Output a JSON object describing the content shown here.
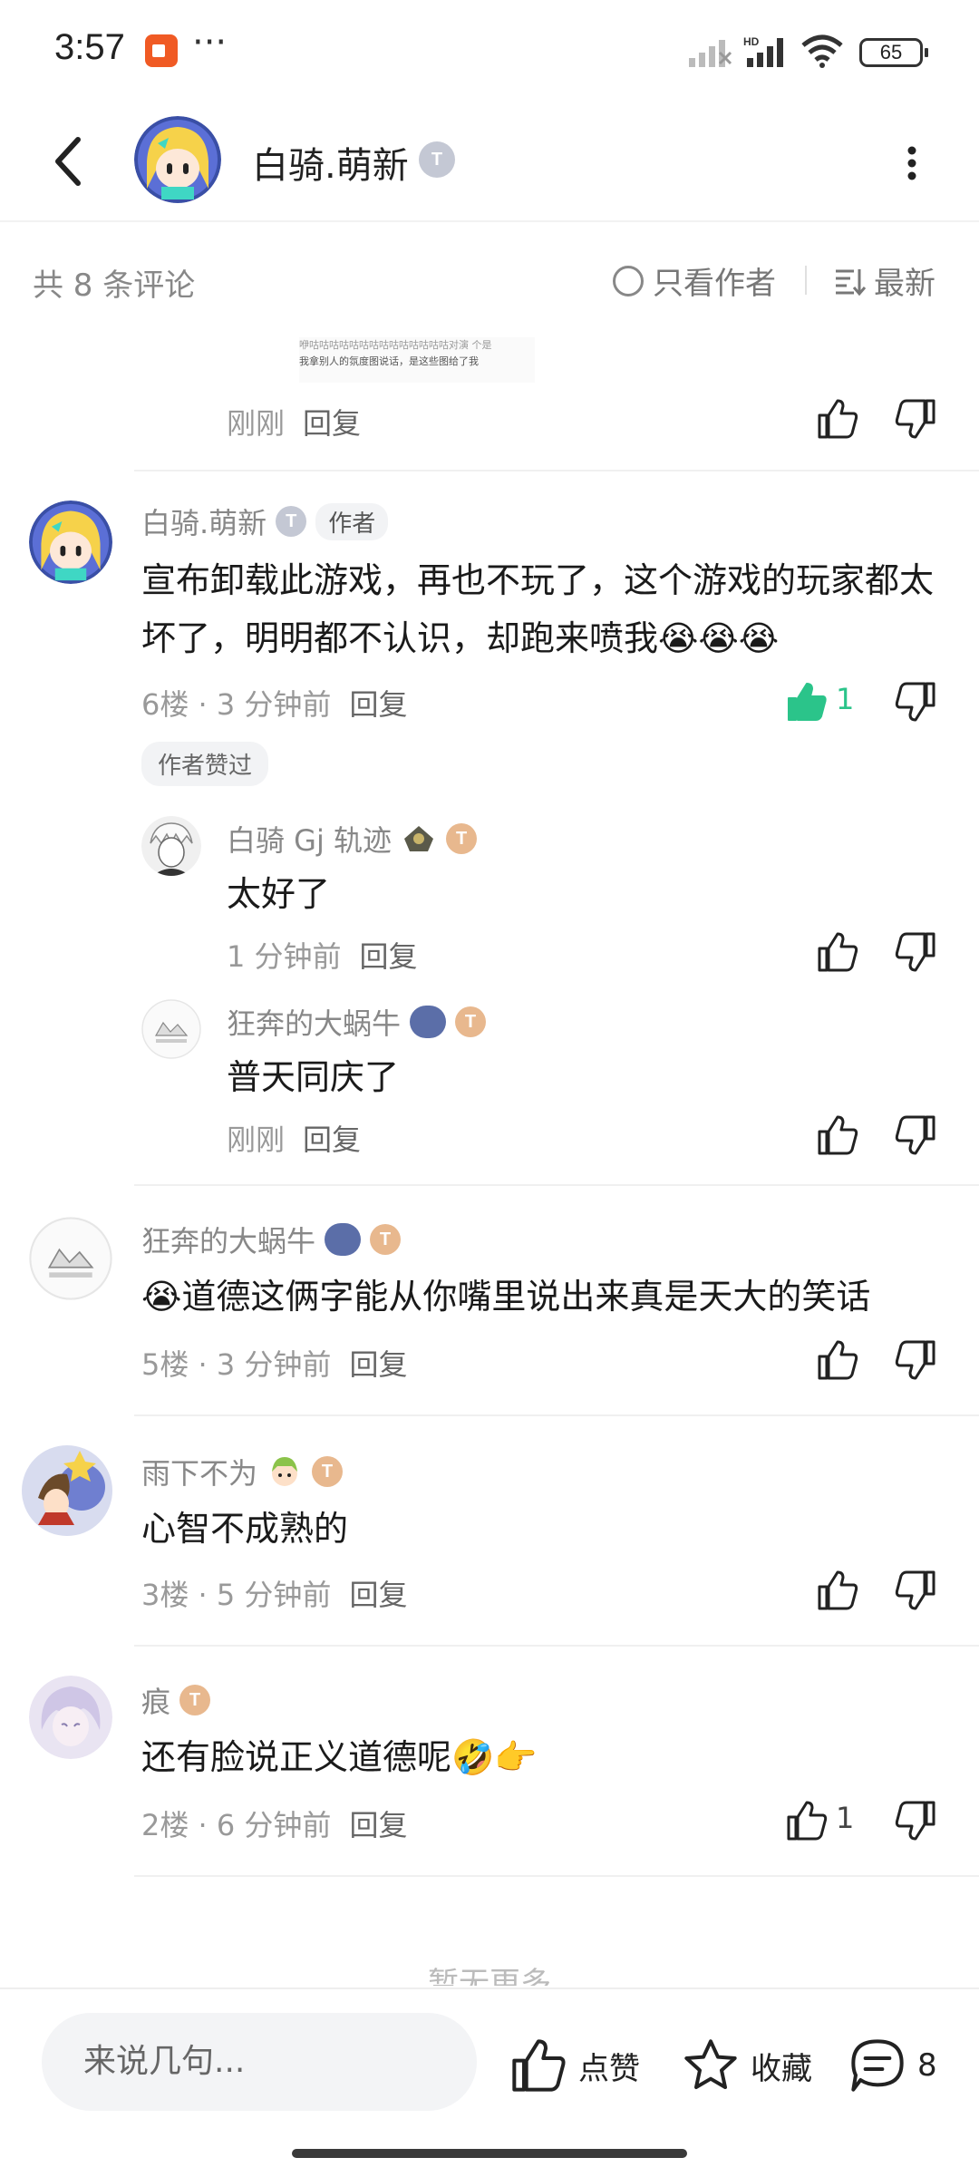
{
  "status_bar": {
    "time": "3:57",
    "dots": "···",
    "battery": "65"
  },
  "header": {
    "user_name": "白骑.萌新",
    "level_badge": "T"
  },
  "sort_bar": {
    "count_label": "共 8 条评论",
    "only_author_label": "只看作者",
    "sort_label": "最新"
  },
  "image_snippet": {
    "line1": "咿咕咕咕咕咕咕咕咕咕咕咕咕咕咕对演   个是",
    "line2": "我拿别人的氛度图说话，是这些图给了我"
  },
  "top_comment_tail": {
    "time": "刚刚",
    "reply": "回复"
  },
  "comments": [
    {
      "name": "白骑.萌新",
      "badge": "T",
      "tag": "作者",
      "text": "宣布卸载此游戏，再也不玩了，这个游戏的玩家都太坏了，明明都不认识，却跑来喷我😭😭😭",
      "floor": "6楼",
      "time": "3 分钟前",
      "reply": "回复",
      "likes": "1",
      "liked_tag": "作者赞过",
      "replies": [
        {
          "name": "白骑 Gj 轨迹",
          "badge": "T",
          "text": "太好了",
          "time": "1 分钟前",
          "reply": "回复"
        },
        {
          "name": "狂奔的大蜗牛",
          "badge": "T",
          "text": "普天同庆了",
          "time": "刚刚",
          "reply": "回复"
        }
      ]
    },
    {
      "name": "狂奔的大蜗牛",
      "badge": "T",
      "text": "😭道德这俩字能从你嘴里说出来真是天大的笑话",
      "floor": "5楼",
      "time": "3 分钟前",
      "reply": "回复"
    },
    {
      "name": "雨下不为",
      "badge": "T",
      "text": "心智不成熟的",
      "floor": "3楼",
      "time": "5 分钟前",
      "reply": "回复"
    },
    {
      "name": "痕",
      "badge": "T",
      "text": "还有脸说正义道德呢🤣👉",
      "floor": "2楼",
      "time": "6 分钟前",
      "reply": "回复",
      "likes": "1"
    }
  ],
  "meta_sep": " · ",
  "no_more": "暂无更多",
  "bottom_bar": {
    "input_placeholder": "来说几句...",
    "like_label": "点赞",
    "fav_label": "收藏",
    "comment_count": "8"
  },
  "colors": {
    "accent_green": "#2bc48a",
    "badge_silver": "#c4c8d4",
    "badge_bronze": "#e8b88e",
    "text_gray": "#888888"
  }
}
